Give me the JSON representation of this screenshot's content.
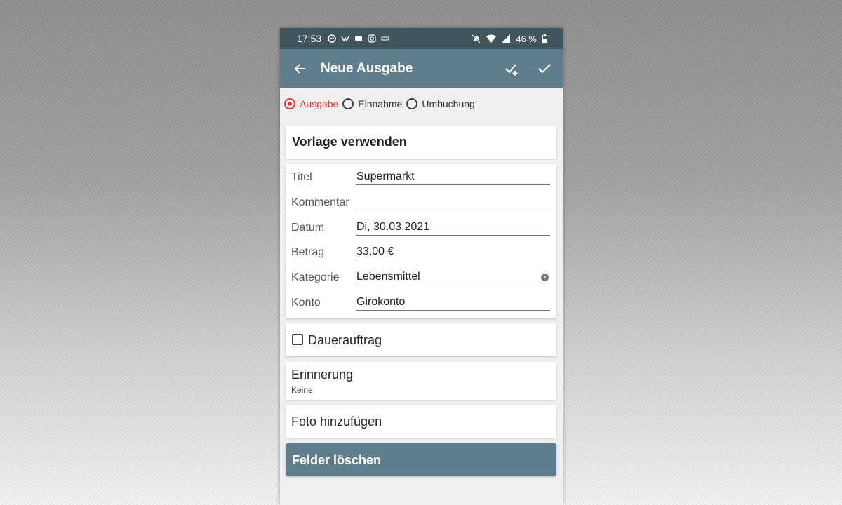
{
  "status_bar": {
    "time": "17:53",
    "left_icons": [
      "messenger-icon",
      "tinder-like-icon",
      "bp-icon",
      "instagram-icon",
      "rewe-icon"
    ],
    "battery": "46 %"
  },
  "app_bar": {
    "title": "Neue Ausgabe",
    "back_icon": "arrow-left-icon",
    "actions": [
      "check-plus-icon",
      "check-icon"
    ]
  },
  "type_selector": {
    "options": [
      {
        "label": "Ausgabe",
        "selected": true
      },
      {
        "label": "Einnahme",
        "selected": false
      },
      {
        "label": "Umbuchung",
        "selected": false
      }
    ]
  },
  "template_card": {
    "label": "Vorlage verwenden"
  },
  "form": {
    "fields": [
      {
        "label": "Titel",
        "value": "Supermarkt"
      },
      {
        "label": "Kommentar",
        "value": ""
      },
      {
        "label": "Datum",
        "value": "Di, 30.03.2021"
      },
      {
        "label": "Betrag",
        "value": "33,00 €"
      },
      {
        "label": "Kategorie",
        "value": "Lebensmittel"
      },
      {
        "label": "Konto",
        "value": "Girokonto"
      }
    ]
  },
  "recurring": {
    "label": "Dauerauftrag",
    "checked": false
  },
  "reminder": {
    "label": "Erinnerung",
    "value": "Keine"
  },
  "photo": {
    "label": "Foto hinzufügen"
  },
  "clear_button": {
    "label": "Felder löschen"
  },
  "colors": {
    "status_bar": "#41555e",
    "app_bar": "#607d8b",
    "accent": "#e53935",
    "background": "#efefef"
  }
}
